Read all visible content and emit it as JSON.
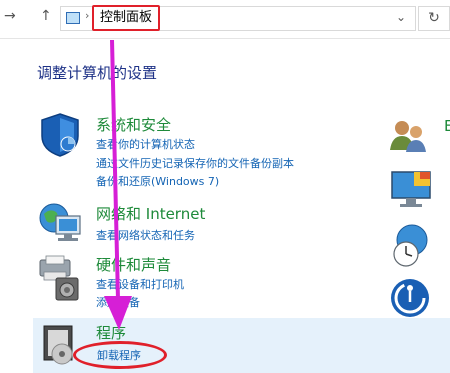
{
  "nav": {
    "back": "→",
    "up": "↑"
  },
  "address": {
    "breadcrumb": "控制面板",
    "separator": "›",
    "dropdown": "⌄",
    "refresh": "↻"
  },
  "page": {
    "title": "调整计算机的设置"
  },
  "categories": [
    {
      "title": "系统和安全",
      "links": [
        "查看你的计算机状态",
        "通过文件历史记录保存你的文件备份副本",
        "备份和还原(Windows 7)"
      ]
    },
    {
      "title": "网络和 Internet",
      "links": [
        "查看网络状态和任务"
      ]
    },
    {
      "title": "硬件和声音",
      "links": [
        "查看设备和打印机",
        "添加设备"
      ]
    },
    {
      "title": "程序",
      "links": [
        "卸载程序"
      ]
    }
  ],
  "right": {
    "partial_label": "E"
  },
  "colors": {
    "title": "#1e3287",
    "category": "#1e8a3a",
    "link": "#1464b4",
    "annotation_red": "#e0202a",
    "annotation_arrow": "#d61fd6",
    "selected_band": "#e5f1fb"
  }
}
